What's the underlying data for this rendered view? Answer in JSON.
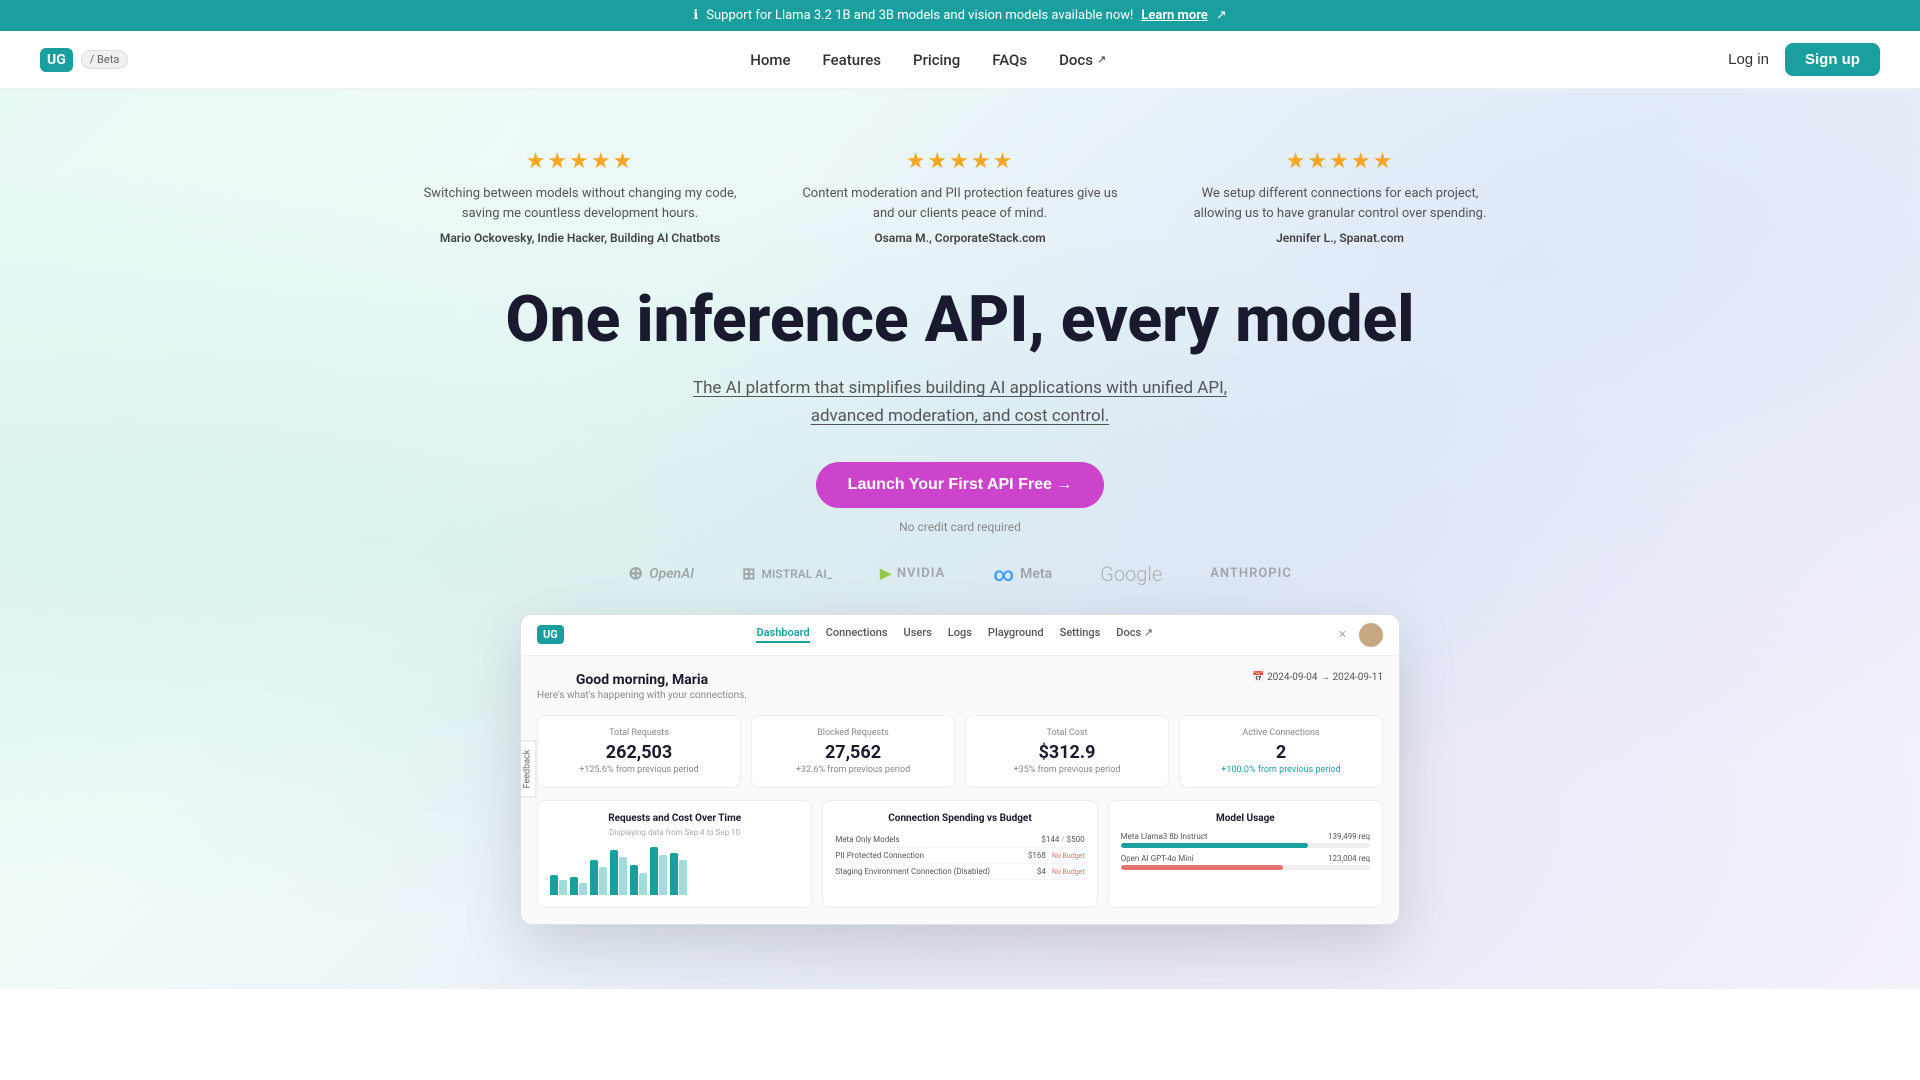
{
  "announcement": {
    "text": "Support for Llama 3.2 1B and 3B models and vision models available now!",
    "link_text": "Learn more",
    "icon": "ℹ"
  },
  "navbar": {
    "logo": "UG",
    "beta": "/ Beta",
    "links": [
      {
        "label": "Home",
        "id": "home"
      },
      {
        "label": "Features",
        "id": "features"
      },
      {
        "label": "Pricing",
        "id": "pricing"
      },
      {
        "label": "FAQs",
        "id": "faqs"
      },
      {
        "label": "Docs",
        "id": "docs",
        "external": true
      }
    ],
    "login": "Log in",
    "signup": "Sign up"
  },
  "reviews": [
    {
      "stars": "★★★★★",
      "text": "Switching between models without changing my code, saving me countless development hours.",
      "author": "Mario Ockovesky, Indie Hacker, Building AI Chatbots"
    },
    {
      "stars": "★★★★★",
      "text": "Content moderation and PII protection features give us and our clients peace of mind.",
      "author": "Osama M., CorporateStack.com"
    },
    {
      "stars": "★★★★★",
      "text": "We setup different connections for each project, allowing us to have granular control over spending.",
      "author": "Jennifer L., Spanat.com"
    }
  ],
  "hero": {
    "heading": "One inference API, every model",
    "subtitle_pre": "The AI platform that simplifies ",
    "subtitle_link": "building AI applications",
    "subtitle_post": " with unified API, advanced moderation, and cost control.",
    "cta": "Launch Your First API Free →",
    "no_cc": "No credit card required"
  },
  "logos": [
    {
      "name": "OpenAI",
      "id": "openai"
    },
    {
      "name": "MISTRAL AI_",
      "id": "mistral"
    },
    {
      "name": "NVIDIA",
      "id": "nvidia"
    },
    {
      "name": "Meta",
      "id": "meta"
    },
    {
      "name": "Google",
      "id": "google"
    },
    {
      "name": "ANTHROPIC",
      "id": "anthropic"
    }
  ],
  "dashboard": {
    "logo": "UG",
    "nav_links": [
      "Dashboard",
      "Connections",
      "Users",
      "Logs",
      "Playground",
      "Settings",
      "Docs ↗"
    ],
    "greeting": "Good morning, Maria",
    "sub": "Here's what's happening with your connections.",
    "date_range": "2024-09-04 → 2024-09-11",
    "stats": [
      {
        "label": "Total Requests",
        "value": "262,503",
        "change": "+125.6% from previous period"
      },
      {
        "label": "Blocked Requests",
        "value": "27,562",
        "change": "+32.6% from previous period"
      },
      {
        "label": "Total Cost",
        "value": "$312.9",
        "change": "+35% from previous period"
      },
      {
        "label": "Active Connections",
        "value": "2",
        "change": "+100.0% from previous period"
      }
    ],
    "chart1": {
      "title": "Requests and Cost Over Time",
      "sub": "Displaying data from Sep 4 to Sep 10",
      "bars": [
        {
          "h1": 20,
          "h2": 15
        },
        {
          "h1": 18,
          "h2": 12
        },
        {
          "h1": 35,
          "h2": 28
        },
        {
          "h1": 45,
          "h2": 38
        },
        {
          "h1": 30,
          "h2": 22
        },
        {
          "h1": 48,
          "h2": 40
        },
        {
          "h1": 42,
          "h2": 35
        }
      ]
    },
    "chart2": {
      "title": "Connection Spending vs Budget",
      "connections": [
        {
          "name": "Meta Only Models",
          "spend": "$144",
          "budget": "$500"
        },
        {
          "name": "PII Protected Connection",
          "spend": "$168",
          "budget": "No Budget",
          "over": true
        },
        {
          "name": "Staging Environment Connection (Disabled)",
          "spend": "$4",
          "budget": "No Budget",
          "over": true
        }
      ]
    },
    "chart3": {
      "title": "Model Usage",
      "models": [
        {
          "name": "Meta Llama3 8b Instruct",
          "count": "139,499 req",
          "pct": 75,
          "color": "teal"
        },
        {
          "name": "Open AI GPT-4o Mini",
          "count": "123,004 req",
          "pct": 65,
          "color": "pink"
        }
      ]
    },
    "feedback": "Feedback"
  }
}
